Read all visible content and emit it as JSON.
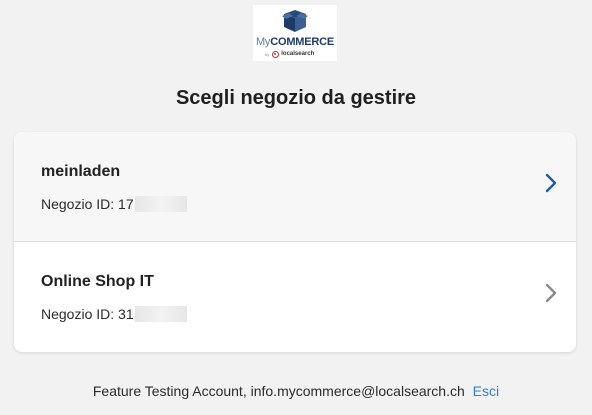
{
  "brand": {
    "logo_prefix": "My",
    "logo_name": "COMMERCE",
    "logo_by": "by",
    "logo_partner": "localsearch",
    "icon": "box-icon"
  },
  "page": {
    "title": "Scegli negozio da gestire"
  },
  "shops": [
    {
      "name": "meinladen",
      "id_label": "Negozio ID:",
      "id_value": "17",
      "chevron": "chevron-right-icon",
      "chevron_color": "#1f5c99"
    },
    {
      "name": "Online Shop IT",
      "id_label": "Negozio ID:",
      "id_value": "31",
      "chevron": "chevron-right-icon",
      "chevron_color": "#8a8a8a"
    }
  ],
  "footer": {
    "account_text": "Feature Testing Account, info.mycommerce@localsearch.ch",
    "logout_label": "Esci",
    "link_color": "#2f7fd6"
  }
}
